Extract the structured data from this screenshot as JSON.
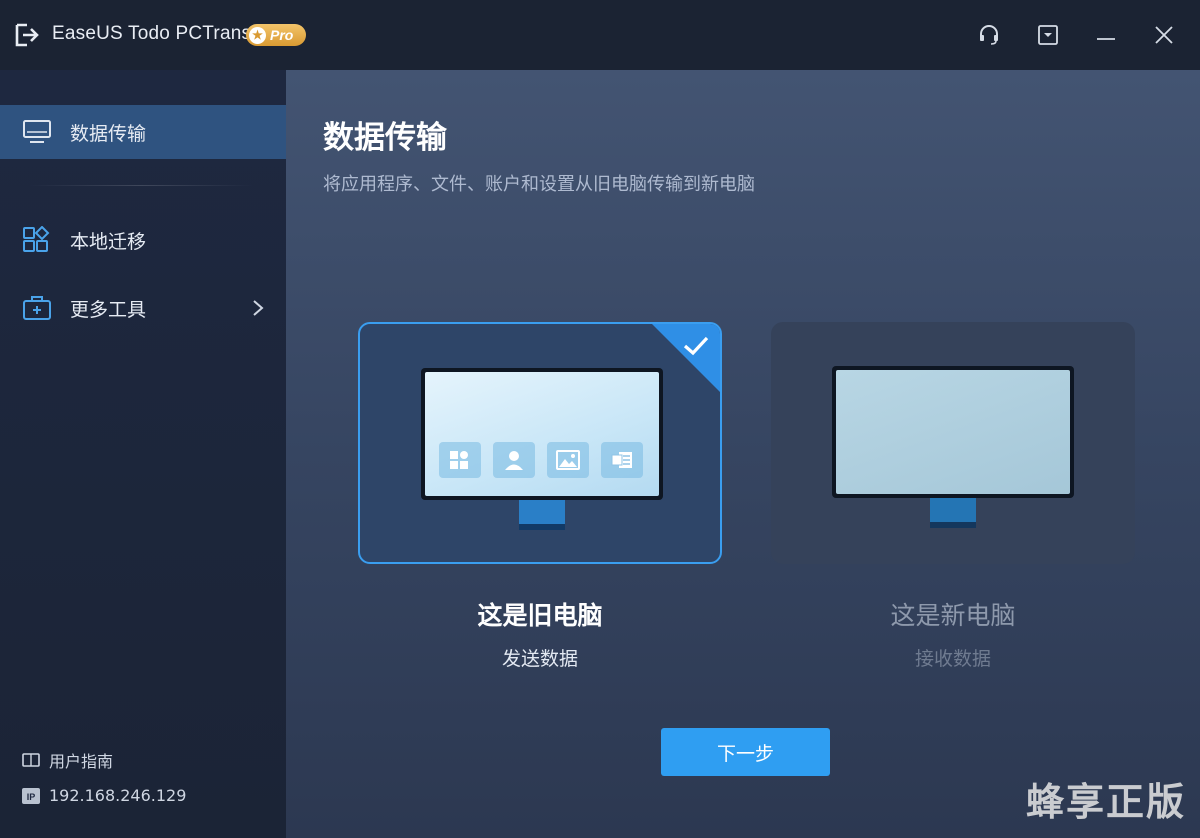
{
  "app": {
    "title": "EaseUS Todo PCTrans",
    "badge": "Pro"
  },
  "sidebar": {
    "items": [
      {
        "label": "数据传输",
        "icon": "monitor-icon",
        "active": true
      },
      {
        "label": "本地迁移",
        "icon": "apps-grid-icon",
        "active": false
      },
      {
        "label": "更多工具",
        "icon": "toolbox-icon",
        "active": false
      }
    ],
    "footer": {
      "guide_label": "用户指南",
      "ip_label": "192.168.246.129",
      "ip_badge": "IP"
    }
  },
  "main": {
    "title": "数据传输",
    "subtitle": "将应用程序、文件、账户和设置从旧电脑传输到新电脑",
    "old_pc": {
      "title": "这是旧电脑",
      "subtitle": "发送数据",
      "selected": true
    },
    "new_pc": {
      "title": "这是新电脑",
      "subtitle": "接收数据",
      "selected": false
    },
    "next_button": "下一步"
  },
  "watermark": "蜂享正版",
  "colors": {
    "accent": "#2f9ef2",
    "active_nav": "#2f5380",
    "badge_gold": "#e3a842"
  }
}
